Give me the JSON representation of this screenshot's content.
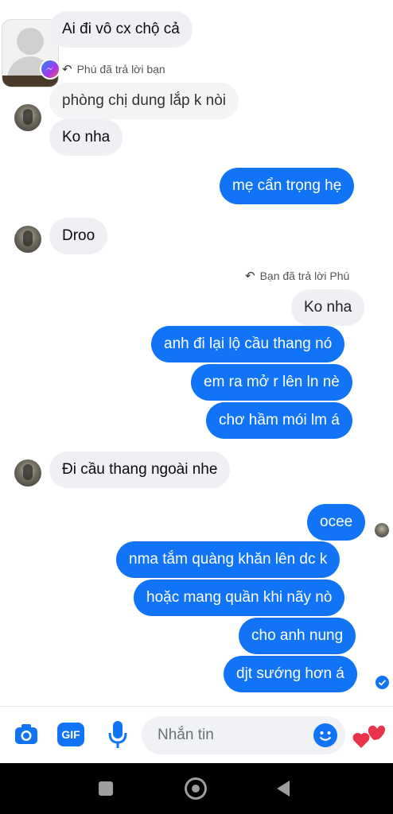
{
  "messages": {
    "m1": "Ai đi vô cx chộ cả",
    "reply_note_1": "Phú đã trả lời bạn",
    "m2": "phòng chị dung lắp k nòi",
    "m3": "Ko nha",
    "m4": "mẹ cẩn trọng hẹ",
    "m5": "Droo",
    "reply_note_2": "Bạn đã trả lời Phú",
    "quoted": "Ko nha",
    "m6": "anh đi lại lộ cầu thang nó",
    "m7": "em ra mở r lên ln nè",
    "m8": "chơ hầm mói lm á",
    "m9": "Đi cầu thang ngoài nhe",
    "m10": "ocee",
    "m11": "nma tắm quàng khăn lên dc k",
    "m12": "hoặc mang quần khi nãy nò",
    "m13": "cho anh nung",
    "m14": "djt sướng hơn á"
  },
  "composer": {
    "placeholder": "Nhắn tin",
    "gif_label": "GIF"
  },
  "colors": {
    "accent": "#1173f5",
    "incoming_bubble": "#eef0f3",
    "heart": "#e8334a"
  },
  "icons": [
    "camera-icon",
    "gif-icon",
    "microphone-icon",
    "emoji-icon",
    "heart-icon",
    "square-icon",
    "circle-icon",
    "back-triangle-icon",
    "messenger-icon",
    "reply-icon",
    "read-receipt-icon"
  ]
}
